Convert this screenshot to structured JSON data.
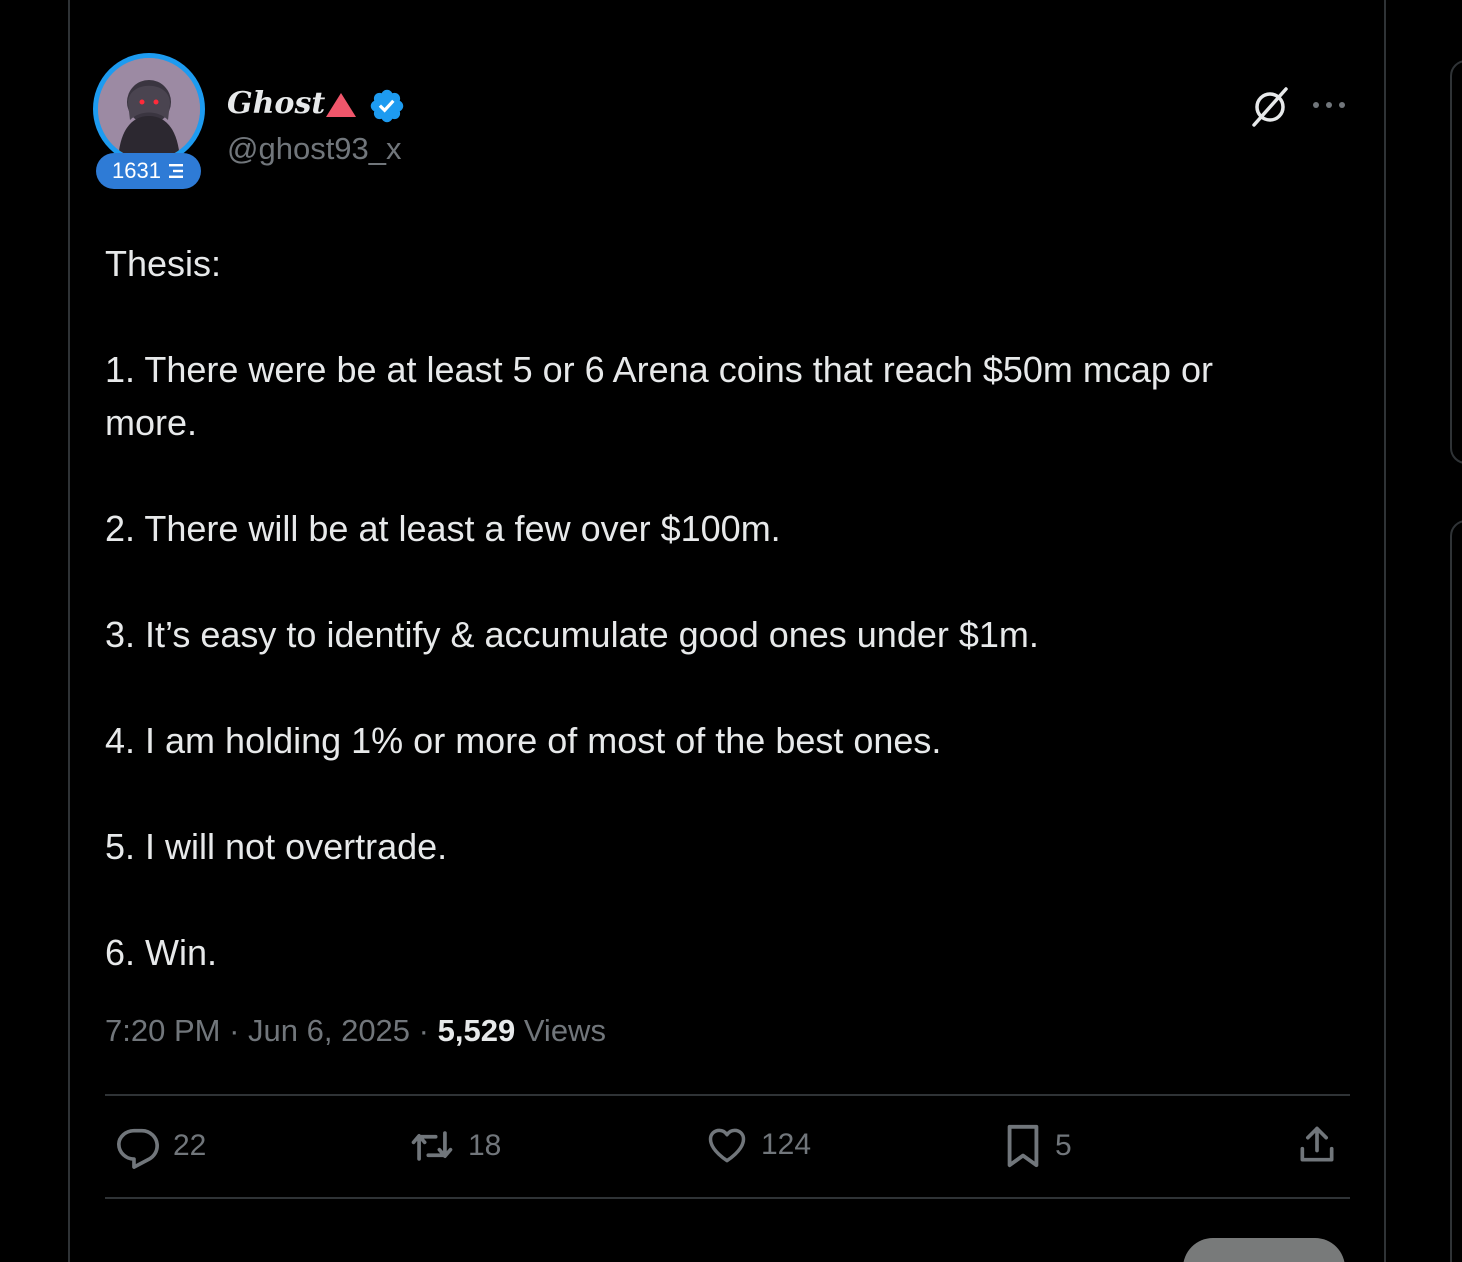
{
  "author": {
    "display_name": "Ghost",
    "handle": "@ghost93_x",
    "score": "1631",
    "accent_color": "#1d9bf0",
    "triangle_color": "#f0566b"
  },
  "icons": {
    "verified": "verified-badge-icon",
    "grok": "grok-icon",
    "more": "more-options-icon",
    "reply": "reply-icon",
    "repost": "repost-icon",
    "like": "heart-icon",
    "bookmark": "bookmark-icon",
    "share": "share-icon"
  },
  "tweet": {
    "lines": [
      "Thesis:",
      "1. There were be at least 5 or 6 Arena coins that reach $50m mcap or more.",
      "2. There will be at least a few over $100m.",
      "3. It’s easy to identify & accumulate good ones under $1m.",
      "4. I am holding 1% or more of most of the best ones.",
      "5. I will not overtrade.",
      "6. Win."
    ],
    "time": "7:20 PM",
    "date": "Jun 6, 2025",
    "views_count": "5,529",
    "views_label": "Views"
  },
  "actions": {
    "replies": "22",
    "reposts": "18",
    "likes": "124",
    "bookmarks": "5"
  }
}
